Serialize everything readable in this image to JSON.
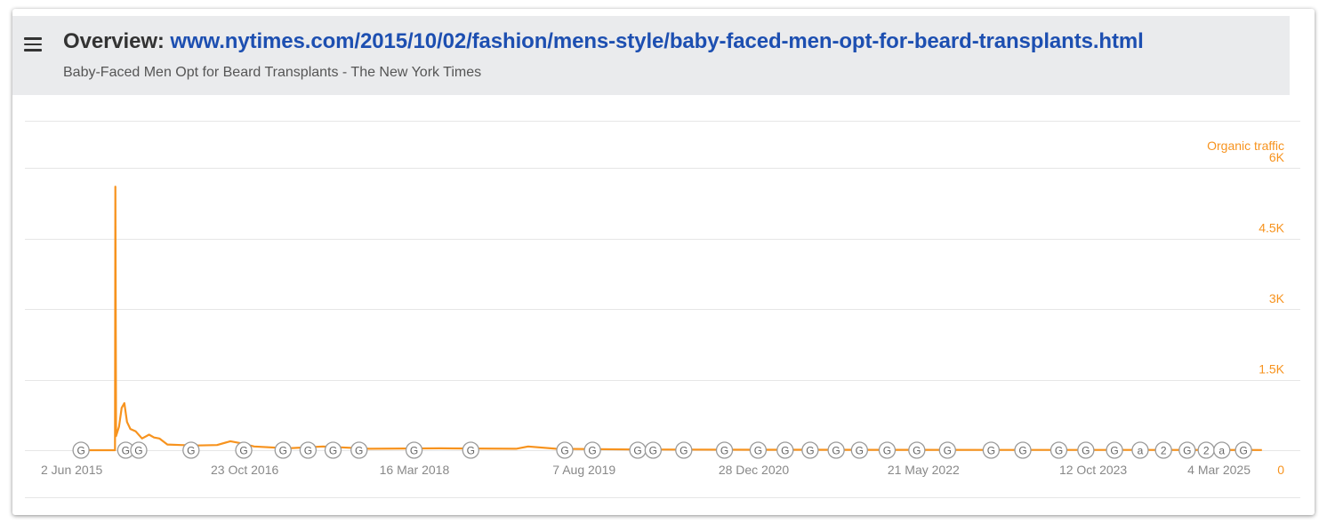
{
  "header": {
    "title_label": "Overview:",
    "title_url": "www.nytimes.com/2015/10/02/fashion/mens-style/baby-faced-men-opt-for-beard-transplants.html",
    "subtitle": "Baby-Faced Men Opt for Beard Transplants - The New York Times"
  },
  "icons": {
    "menu": "hamburger-menu-icon",
    "annotation": "google-update-marker-icon"
  },
  "colors": {
    "series": "#f7931e",
    "title_url": "#1d4fb1",
    "header_bg": "#eaebed",
    "grid": "#e6e6e6",
    "marker_stroke": "#9a9a9a"
  },
  "chart_data": {
    "type": "line",
    "title": "",
    "xlabel": "",
    "ylabel": "Organic traffic",
    "x_ticks": [
      "2 Jun 2015",
      "23 Oct 2016",
      "16 Mar 2018",
      "7 Aug 2019",
      "28 Dec 2020",
      "21 May 2022",
      "12 Oct 2023",
      "4 Mar 2025"
    ],
    "y_ticks": [
      "0",
      "1.5K",
      "3K",
      "4.5K",
      "6K"
    ],
    "ylim": [
      0,
      7000
    ],
    "xlim": [
      "2015-05-08",
      "2025-03-31"
    ],
    "grid": true,
    "legend": "top-right",
    "series": [
      {
        "name": "Organic traffic",
        "color": "#f7931e",
        "points": [
          [
            "2015-08-01",
            0
          ],
          [
            "2015-09-30",
            0
          ],
          [
            "2015-10-01",
            5600
          ],
          [
            "2015-10-03",
            300
          ],
          [
            "2015-10-12",
            500
          ],
          [
            "2015-10-20",
            900
          ],
          [
            "2015-10-28",
            1000
          ],
          [
            "2015-11-05",
            600
          ],
          [
            "2015-11-15",
            450
          ],
          [
            "2015-12-01",
            400
          ],
          [
            "2015-12-20",
            250
          ],
          [
            "2016-01-10",
            330
          ],
          [
            "2016-01-25",
            270
          ],
          [
            "2016-02-10",
            250
          ],
          [
            "2016-03-05",
            120
          ],
          [
            "2016-04-15",
            110
          ],
          [
            "2016-06-01",
            100
          ],
          [
            "2016-08-01",
            110
          ],
          [
            "2016-09-10",
            190
          ],
          [
            "2016-10-10",
            150
          ],
          [
            "2016-11-20",
            80
          ],
          [
            "2017-03-01",
            40
          ],
          [
            "2017-06-15",
            80
          ],
          [
            "2017-11-01",
            30
          ],
          [
            "2018-06-01",
            40
          ],
          [
            "2019-01-15",
            30
          ],
          [
            "2019-02-20",
            80
          ],
          [
            "2019-05-15",
            30
          ],
          [
            "2020-01-01",
            15
          ],
          [
            "2021-01-01",
            10
          ],
          [
            "2022-01-01",
            8
          ],
          [
            "2023-01-01",
            6
          ],
          [
            "2024-01-01",
            5
          ],
          [
            "2025-03-01",
            4
          ]
        ]
      }
    ],
    "annotations": [
      {
        "date": "2015-06-20",
        "label": "G"
      },
      {
        "date": "2015-11-01",
        "label": "G"
      },
      {
        "date": "2015-12-10",
        "label": "G"
      },
      {
        "date": "2016-05-15",
        "label": "G"
      },
      {
        "date": "2016-10-20",
        "label": "G"
      },
      {
        "date": "2017-02-15",
        "label": "G"
      },
      {
        "date": "2017-05-01",
        "label": "G"
      },
      {
        "date": "2017-07-15",
        "label": "G"
      },
      {
        "date": "2017-10-01",
        "label": "G"
      },
      {
        "date": "2018-03-15",
        "label": "G"
      },
      {
        "date": "2018-09-01",
        "label": "G"
      },
      {
        "date": "2019-06-10",
        "label": "G"
      },
      {
        "date": "2019-09-01",
        "label": "G"
      },
      {
        "date": "2020-01-15",
        "label": "G"
      },
      {
        "date": "2020-03-01",
        "label": "G"
      },
      {
        "date": "2020-06-01",
        "label": "G"
      },
      {
        "date": "2020-10-01",
        "label": "G"
      },
      {
        "date": "2021-01-10",
        "label": "G"
      },
      {
        "date": "2021-04-01",
        "label": "G"
      },
      {
        "date": "2021-06-15",
        "label": "G"
      },
      {
        "date": "2021-09-01",
        "label": "G"
      },
      {
        "date": "2021-11-10",
        "label": "G"
      },
      {
        "date": "2022-02-01",
        "label": "G"
      },
      {
        "date": "2022-05-01",
        "label": "G"
      },
      {
        "date": "2022-08-01",
        "label": "G"
      },
      {
        "date": "2022-12-10",
        "label": "G"
      },
      {
        "date": "2023-03-15",
        "label": "G"
      },
      {
        "date": "2023-07-01",
        "label": "G"
      },
      {
        "date": "2023-09-20",
        "label": "G"
      },
      {
        "date": "2023-12-15",
        "label": "G"
      },
      {
        "date": "2024-03-01",
        "label": "a"
      },
      {
        "date": "2024-05-10",
        "label": "2"
      },
      {
        "date": "2024-07-20",
        "label": "G"
      },
      {
        "date": "2024-09-15",
        "label": "2"
      },
      {
        "date": "2024-11-01",
        "label": "a"
      },
      {
        "date": "2025-01-05",
        "label": "G"
      }
    ]
  }
}
